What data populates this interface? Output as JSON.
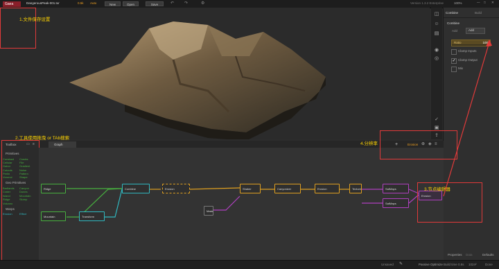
{
  "topbar": {
    "logo": "Gaea",
    "filename": "DangerousPeak-001.tor",
    "resolution": "0.5k",
    "resolution_mode": "Auto",
    "new_label": "New",
    "open_label": "Open",
    "save_label": "Save",
    "version": "Version 1.3.2 Enterprise",
    "zoom": "100%"
  },
  "colors": {
    "accent": "#f0a020",
    "logo_bg": "#8a1f2a",
    "annotation": "#e23a3a",
    "annotation_text": "#ffd400"
  },
  "annotations": {
    "save_settings": "1.文件保存设置",
    "toolbox_tip": "2.工具使用拖曳 or  TAb搜索",
    "resolution": "4.分辨率",
    "node_editor": "3.节点编辑器"
  },
  "toolbox": {
    "title": "Toolbox",
    "sections": [
      {
        "name": "Primitives",
        "items": [
          "Constant",
          "Cracks",
          "Cellular",
          "File",
          "Gabor",
          "Gradient",
          "Cutouts",
          "Noise",
          "Perlin",
          "Pattern",
          "Voronoi",
          "Shape"
        ]
      },
      {
        "name": "Geo Primitives",
        "items": [
          "Badlands",
          "Canyon",
          "Crater",
          "Dunes",
          "Island",
          "Mountain",
          "Ridge",
          "Slump",
          "Volcano"
        ]
      },
      {
        "name": "Warps",
        "items": [
          "Erosion",
          "Effect"
        ]
      }
    ]
  },
  "graph": {
    "tab": "Graph",
    "nodes": [
      "Ridge",
      "Combine",
      "Erosion",
      "Shaker",
      "Canyonizer",
      "Erosion",
      "Texture",
      "SatMaps",
      "SatMaps",
      "Mountain",
      "Transform",
      "Mask",
      "Combine"
    ],
    "output_label": "Erosion"
  },
  "viewport_bar": {
    "zoom_label": "Erosion"
  },
  "properties": {
    "title": "Combine",
    "tabs": [
      "Combine",
      "Build"
    ],
    "section": "Combine",
    "mode_label": "Add",
    "mode_value": "Add",
    "ratio_label": "Ratio",
    "ratio_value": "100",
    "ratio_fraction": 1.0,
    "checkboxes": [
      {
        "label": "Clamp Inputs",
        "checked": false
      },
      {
        "label": "Clamp Output",
        "checked": true
      },
      {
        "label": "Mix",
        "checked": false
      }
    ],
    "footer_tabs": [
      "Properties",
      "Data",
      "Defaults"
    ]
  },
  "statusbar": {
    "items": [
      "Unsaved",
      "Passive Optimize",
      "Build time 0.8s",
      "1024²",
      "Done"
    ]
  }
}
